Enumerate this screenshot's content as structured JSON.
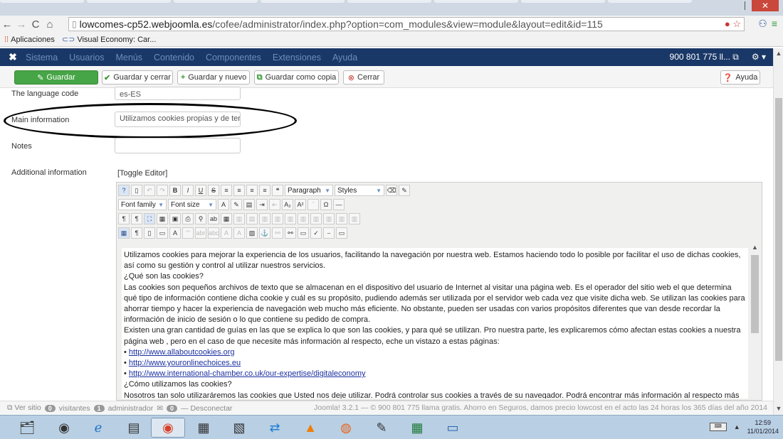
{
  "browser": {
    "url_domain": "lowcomes-cp52.webjoomla.es",
    "url_path": "/cofee/administrator/index.php?option=com_modules&view=module&layout=edit&id=115",
    "bookmarks": [
      {
        "label": "Aplicaciones",
        "icon": "apps-icon"
      },
      {
        "label": "Visual Economy: Car...",
        "icon": "link-icon"
      }
    ]
  },
  "joomla_nav": {
    "logo": "joomla-logo",
    "menu": [
      "Sistema",
      "Usuarios",
      "Menús",
      "Contenido",
      "Componentes",
      "Extensiones",
      "Ayuda"
    ],
    "site_label": "900 801 775 ll...",
    "colors": {
      "bar": "#1a3867",
      "menu_text": "#6f8dba"
    }
  },
  "toolbar": {
    "save": "Guardar",
    "save_close": "Guardar y cerrar",
    "save_new": "Guardar y nuevo",
    "save_copy": "Guardar como copia",
    "close": "Cerrar",
    "help": "Ayuda",
    "colors": {
      "save": "#46a546",
      "close_icon": "#c23b2a"
    }
  },
  "form": {
    "language_code_label": "The language code",
    "language_code_value": "es-ES",
    "main_info_label": "Main information",
    "main_info_value": "Utilizamos cookies propias y de terc",
    "notes_label": "Notes",
    "notes_value": "",
    "additional_label": "Additional information",
    "toggle_editor": "[Toggle Editor]"
  },
  "editor": {
    "format_select": "Paragraph",
    "styles_select": "Styles",
    "font_family_select": "Font family",
    "font_size_select": "Font size",
    "content": {
      "p1": "Utilizamos cookies para mejorar la experiencia de los usuarios, facilitando la navegación por nuestra web. Estamos haciendo todo lo posible por facilitar el uso de dichas cookies, así como su gestión y control al utilizar nuestros servicios.",
      "h1": "¿Qué son las cookies?",
      "p2": "Las cookies son pequeños archivos de texto que se almacenan en el dispositivo del usuario de Internet al visitar una página web. Es el operador del sitio web el que determina qué tipo de información contiene dicha cookie y cuál es su propósito, pudiendo además ser utilizada por el servidor web cada vez que visite dicha web. Se utilizan las cookies para ahorrar tiempo y hacer la experiencia de navegación web mucho más eficiente. No obstante, pueden ser usadas con varios propósitos diferentes que van desde recordar la información de inicio de sesión o lo que contiene su pedido de compra.",
      "p3": "Existen una gran cantidad de guías en las que se explica lo que son las cookies, y para qué se utilizan. Pro nuestra parte, les explicaremos cómo afectan estas cookies a nuestra página web , pero en el caso de que necesite más información al respecto, eche un vistazo a estas páginas:",
      "links": [
        "http://www.allaboutcookies.org",
        "http://www.youronlinechoices.eu",
        "http://www.international-chamber.co.uk/our-expertise/digitaleconomy"
      ],
      "h2": "¿Cómo utilizamos las cookies?",
      "p4": "Nosotros tan solo utilizaráremos las cookies que Usted nos deje utilizar. Podrá controlar sus cookies a través de su navegador. Podrá encontrar más información al respecto más adelante. Hemos utilizado algunas de las guías existentes para clasificar las cookies que usamos en varios grupos:"
    }
  },
  "status": {
    "view_site": "Ver sitio",
    "visitors_count": "0",
    "visitors_label": "visitantes",
    "admins_count": "1",
    "admins_label": "administrador",
    "messages_count": "0",
    "logout": "Desconectar",
    "footer": "Joomla! 3.2.1 — © 900 801 775 llama gratis. Ahorro en Seguros, damos precio lowcost en el acto las 24 horas los 365 días del año 2014"
  },
  "taskbar": {
    "time": "12:59",
    "date": "11/01/2014"
  }
}
